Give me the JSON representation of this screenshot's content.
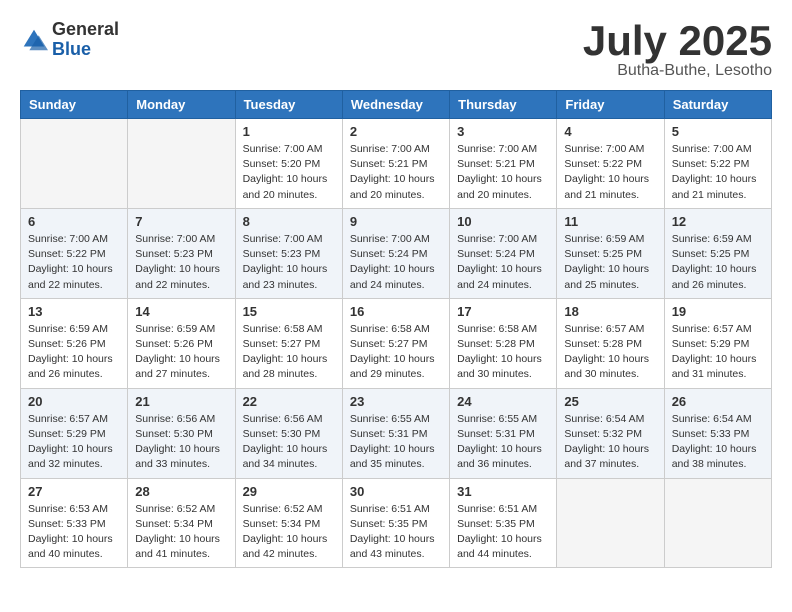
{
  "logo": {
    "general": "General",
    "blue": "Blue"
  },
  "header": {
    "month": "July 2025",
    "location": "Butha-Buthe, Lesotho"
  },
  "weekdays": [
    "Sunday",
    "Monday",
    "Tuesday",
    "Wednesday",
    "Thursday",
    "Friday",
    "Saturday"
  ],
  "weeks": [
    [
      {
        "day": "",
        "info": ""
      },
      {
        "day": "",
        "info": ""
      },
      {
        "day": "1",
        "info": "Sunrise: 7:00 AM\nSunset: 5:20 PM\nDaylight: 10 hours\nand 20 minutes."
      },
      {
        "day": "2",
        "info": "Sunrise: 7:00 AM\nSunset: 5:21 PM\nDaylight: 10 hours\nand 20 minutes."
      },
      {
        "day": "3",
        "info": "Sunrise: 7:00 AM\nSunset: 5:21 PM\nDaylight: 10 hours\nand 20 minutes."
      },
      {
        "day": "4",
        "info": "Sunrise: 7:00 AM\nSunset: 5:22 PM\nDaylight: 10 hours\nand 21 minutes."
      },
      {
        "day": "5",
        "info": "Sunrise: 7:00 AM\nSunset: 5:22 PM\nDaylight: 10 hours\nand 21 minutes."
      }
    ],
    [
      {
        "day": "6",
        "info": "Sunrise: 7:00 AM\nSunset: 5:22 PM\nDaylight: 10 hours\nand 22 minutes."
      },
      {
        "day": "7",
        "info": "Sunrise: 7:00 AM\nSunset: 5:23 PM\nDaylight: 10 hours\nand 22 minutes."
      },
      {
        "day": "8",
        "info": "Sunrise: 7:00 AM\nSunset: 5:23 PM\nDaylight: 10 hours\nand 23 minutes."
      },
      {
        "day": "9",
        "info": "Sunrise: 7:00 AM\nSunset: 5:24 PM\nDaylight: 10 hours\nand 24 minutes."
      },
      {
        "day": "10",
        "info": "Sunrise: 7:00 AM\nSunset: 5:24 PM\nDaylight: 10 hours\nand 24 minutes."
      },
      {
        "day": "11",
        "info": "Sunrise: 6:59 AM\nSunset: 5:25 PM\nDaylight: 10 hours\nand 25 minutes."
      },
      {
        "day": "12",
        "info": "Sunrise: 6:59 AM\nSunset: 5:25 PM\nDaylight: 10 hours\nand 26 minutes."
      }
    ],
    [
      {
        "day": "13",
        "info": "Sunrise: 6:59 AM\nSunset: 5:26 PM\nDaylight: 10 hours\nand 26 minutes."
      },
      {
        "day": "14",
        "info": "Sunrise: 6:59 AM\nSunset: 5:26 PM\nDaylight: 10 hours\nand 27 minutes."
      },
      {
        "day": "15",
        "info": "Sunrise: 6:58 AM\nSunset: 5:27 PM\nDaylight: 10 hours\nand 28 minutes."
      },
      {
        "day": "16",
        "info": "Sunrise: 6:58 AM\nSunset: 5:27 PM\nDaylight: 10 hours\nand 29 minutes."
      },
      {
        "day": "17",
        "info": "Sunrise: 6:58 AM\nSunset: 5:28 PM\nDaylight: 10 hours\nand 30 minutes."
      },
      {
        "day": "18",
        "info": "Sunrise: 6:57 AM\nSunset: 5:28 PM\nDaylight: 10 hours\nand 30 minutes."
      },
      {
        "day": "19",
        "info": "Sunrise: 6:57 AM\nSunset: 5:29 PM\nDaylight: 10 hours\nand 31 minutes."
      }
    ],
    [
      {
        "day": "20",
        "info": "Sunrise: 6:57 AM\nSunset: 5:29 PM\nDaylight: 10 hours\nand 32 minutes."
      },
      {
        "day": "21",
        "info": "Sunrise: 6:56 AM\nSunset: 5:30 PM\nDaylight: 10 hours\nand 33 minutes."
      },
      {
        "day": "22",
        "info": "Sunrise: 6:56 AM\nSunset: 5:30 PM\nDaylight: 10 hours\nand 34 minutes."
      },
      {
        "day": "23",
        "info": "Sunrise: 6:55 AM\nSunset: 5:31 PM\nDaylight: 10 hours\nand 35 minutes."
      },
      {
        "day": "24",
        "info": "Sunrise: 6:55 AM\nSunset: 5:31 PM\nDaylight: 10 hours\nand 36 minutes."
      },
      {
        "day": "25",
        "info": "Sunrise: 6:54 AM\nSunset: 5:32 PM\nDaylight: 10 hours\nand 37 minutes."
      },
      {
        "day": "26",
        "info": "Sunrise: 6:54 AM\nSunset: 5:33 PM\nDaylight: 10 hours\nand 38 minutes."
      }
    ],
    [
      {
        "day": "27",
        "info": "Sunrise: 6:53 AM\nSunset: 5:33 PM\nDaylight: 10 hours\nand 40 minutes."
      },
      {
        "day": "28",
        "info": "Sunrise: 6:52 AM\nSunset: 5:34 PM\nDaylight: 10 hours\nand 41 minutes."
      },
      {
        "day": "29",
        "info": "Sunrise: 6:52 AM\nSunset: 5:34 PM\nDaylight: 10 hours\nand 42 minutes."
      },
      {
        "day": "30",
        "info": "Sunrise: 6:51 AM\nSunset: 5:35 PM\nDaylight: 10 hours\nand 43 minutes."
      },
      {
        "day": "31",
        "info": "Sunrise: 6:51 AM\nSunset: 5:35 PM\nDaylight: 10 hours\nand 44 minutes."
      },
      {
        "day": "",
        "info": ""
      },
      {
        "day": "",
        "info": ""
      }
    ]
  ]
}
